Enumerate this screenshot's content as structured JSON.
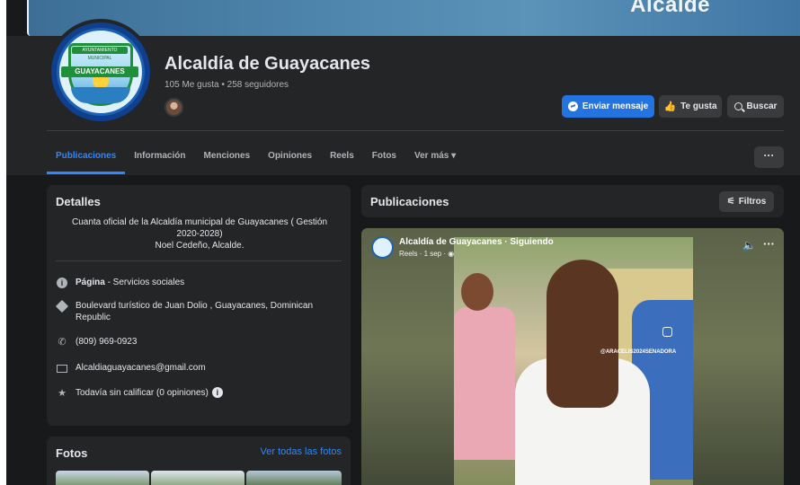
{
  "cover": {
    "text": "Alcalde"
  },
  "page": {
    "name": "Alcaldía de Guayacanes",
    "stats": "105 Me gusta • 258 seguidores",
    "logo": {
      "line1": "AYUNTAMIENTO",
      "line2": "MUNICIPAL",
      "line3": "GUAYACANES"
    }
  },
  "actions": {
    "message": "Enviar mensaje",
    "like": "Te gusta",
    "search": "Buscar",
    "more": "···"
  },
  "tabs": [
    {
      "label": "Publicaciones",
      "active": true
    },
    {
      "label": "Información"
    },
    {
      "label": "Menciones"
    },
    {
      "label": "Opiniones"
    },
    {
      "label": "Reels"
    },
    {
      "label": "Fotos"
    },
    {
      "label": "Ver más"
    }
  ],
  "details": {
    "title": "Detalles",
    "bio": "Cuanta oficial de la Alcaldía municipal de Guayacanes ( Gestión 2020-2028)",
    "bio_sign": "Noel Cedeño, Alcalde.",
    "category_label": "Página",
    "category_value": " - Servicios sociales",
    "address": "Boulevard turístico de Juan Dolio , Guayacanes, Dominican Republic",
    "phone": "(809) 969-0923",
    "email": "Alcaldiaguayacanes@gmail.com",
    "rating": "Todavía sin calificar (0 opiniones)"
  },
  "photos": {
    "title": "Fotos",
    "see_all": "Ver todas las fotos"
  },
  "posts": {
    "title": "Publicaciones",
    "filter": "Filtros",
    "reel": {
      "author": "Alcaldía de Guayacanes · Siguiendo",
      "meta": "Reels · 1 sep · ",
      "watermark": "@ARACELIS2024SENADORA",
      "more": "···"
    }
  },
  "icons": {
    "info": "info-icon",
    "pin": "location-icon",
    "phone": "phone-icon",
    "mail": "mail-icon",
    "star": "star-icon"
  },
  "colors": {
    "accent": "#2d88ff",
    "primary_button": "#2374e1",
    "background": "#18191a",
    "card": "#242526"
  }
}
